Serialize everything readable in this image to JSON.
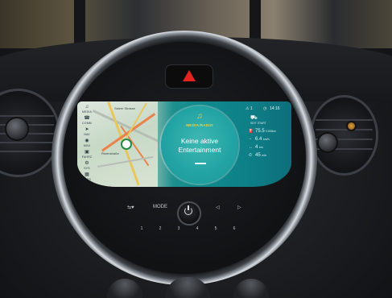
{
  "display": {
    "sidebar": [
      {
        "icon": "music-icon",
        "label": "MEDIA"
      },
      {
        "icon": "phone-icon",
        "label": "COMM"
      },
      {
        "icon": "nav-icon",
        "label": "NAV"
      },
      {
        "icon": "car-icon",
        "label": "MINI"
      },
      {
        "icon": "car-icon",
        "label": "FAHRZ"
      },
      {
        "icon": "settings-icon",
        "label": "SYS"
      },
      {
        "icon": "apps-icon",
        "label": "APPS"
      }
    ],
    "map_labels": [
      "Salzer Strasse",
      "Rheinstraße"
    ],
    "media": {
      "note_glyph": "♫",
      "mode_label": "MEDIA/RADIO",
      "message": "Keine aktive Entertainment"
    },
    "status": {
      "top_left": "⚠ 1",
      "clock": "14:16",
      "car_label": "SEIT START",
      "rows": [
        {
          "icon": "consumption-icon",
          "value": "75.5",
          "unit": "l/100km"
        },
        {
          "icon": "speed-icon",
          "value": "6.4",
          "unit": "km/h"
        },
        {
          "icon": "distance-icon",
          "value": "4",
          "unit": "km"
        },
        {
          "icon": "time-icon",
          "value": "45",
          "unit": "min"
        }
      ]
    }
  },
  "controls": {
    "mode_label": "MODE",
    "prev_glyph": "◁",
    "next_glyph": "▷",
    "fav_glyph": "⇆♥",
    "presets": [
      "1",
      "2",
      "3",
      "4",
      "5",
      "6"
    ]
  }
}
